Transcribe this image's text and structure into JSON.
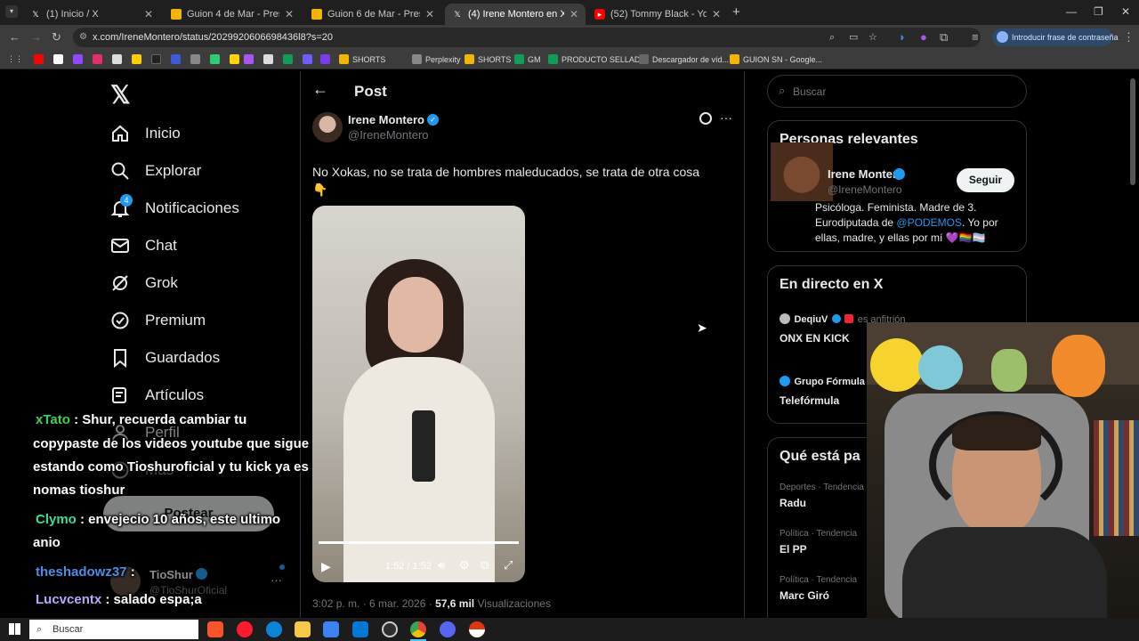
{
  "browser": {
    "tabs": [
      {
        "title": "(1) Inicio / X",
        "icon": "x"
      },
      {
        "title": "Guion 4 de Mar - Presentacione",
        "icon": "slides"
      },
      {
        "title": "Guion 6 de Mar - Presentacione",
        "icon": "slides"
      },
      {
        "title": "(4) Irene Montero en X: \"No Xo",
        "icon": "x"
      },
      {
        "title": "(52) Tommy Black - YouTube",
        "icon": "youtube"
      }
    ],
    "url": "x.com/IreneMontero/status/2029920606698436l8?s=20",
    "password_prompt": "Introducir frase de contraseña",
    "bookmarks": [
      "SHORTS",
      "Perplexity",
      "SHORTS",
      "GM",
      "PRODUCTO SELLAD...",
      "Descargador de víd...",
      "GUION SN - Google..."
    ]
  },
  "nav": {
    "items": [
      "Inicio",
      "Explorar",
      "Notificaciones",
      "Chat",
      "Grok",
      "Premium",
      "Guardados",
      "Artículos",
      "Perfil",
      "Más"
    ],
    "notif_badge": "4",
    "post_button": "Postear",
    "account_name": "TioShur",
    "account_handle": "@TioShurOficial"
  },
  "post": {
    "header": "Post",
    "author_name": "Irene Montero",
    "author_handle": "@IreneMontero",
    "text": "No Xokas, no se trata de hombres maleducados, se trata de otra cosa",
    "emoji": "👇",
    "video_time": "1:52 / 1:52",
    "video_progress": 1.0,
    "timestamp": "3:02 p. m. · 6 mar. 2026 · ",
    "views_count": "57,6 mil",
    "views_label": " Visualizaciones"
  },
  "search": {
    "placeholder": "Buscar"
  },
  "relevant": {
    "title": "Personas relevantes",
    "name": "Irene Montero",
    "handle": "@IreneMontero",
    "follow": "Seguir",
    "bio_1": "Psicóloga. Feminista. Madre de 3.",
    "bio_2a": "Eurodiputada de ",
    "bio_2_link": "@PODEMOS",
    "bio_2b": ". Yo por",
    "bio_3": "ellas, madre, y ellas por mí 💜🏳️‍🌈🏳️‍⚧️"
  },
  "live": {
    "title": "En directo en X",
    "host1": "DeqiuV",
    "host1_role": "es anfitrión",
    "show1": "ONX EN KICK",
    "host2": "Grupo Fórmula",
    "show2": "Telefórmula"
  },
  "trends": {
    "title": "Qué está pa",
    "items": [
      {
        "cat": "Deportes · Tendencia",
        "name": "Radu"
      },
      {
        "cat": "Política · Tendencia",
        "name": "El PP"
      },
      {
        "cat": "Política · Tendencia",
        "name": "Marc Giró"
      }
    ]
  },
  "chat_overlay": [
    {
      "user": "xTato",
      "user_color": "#39d353",
      "msg": " : Shur, recuerda cambiar tu"
    },
    {
      "user": "",
      "user_color": "#ffffff",
      "msg": "copypaste de los videos youtube que sigue"
    },
    {
      "user": "",
      "user_color": "#ffffff",
      "msg": "estando como Tioshuroficial y tu kick ya es"
    },
    {
      "user": "",
      "user_color": "#ffffff",
      "msg": "nomas tioshur"
    },
    {
      "user": "Clymo",
      "user_color": "#3ddc97",
      "msg": " : envejecio 10 años, este ultimo"
    },
    {
      "user": "",
      "user_color": "#ffffff",
      "msg": "anio"
    },
    {
      "user": "theshadowz37",
      "user_color": "#4a8fe7",
      "msg": " :"
    },
    {
      "user": "Lucvcentx",
      "user_color": "#b9a8ff",
      "msg": " : salado espa;a"
    }
  ],
  "taskbar": {
    "search": "Buscar"
  },
  "colors": {
    "accent": "#1d9bf0",
    "bg": "#000000",
    "border": "#2f3336",
    "muted": "#71767b"
  }
}
